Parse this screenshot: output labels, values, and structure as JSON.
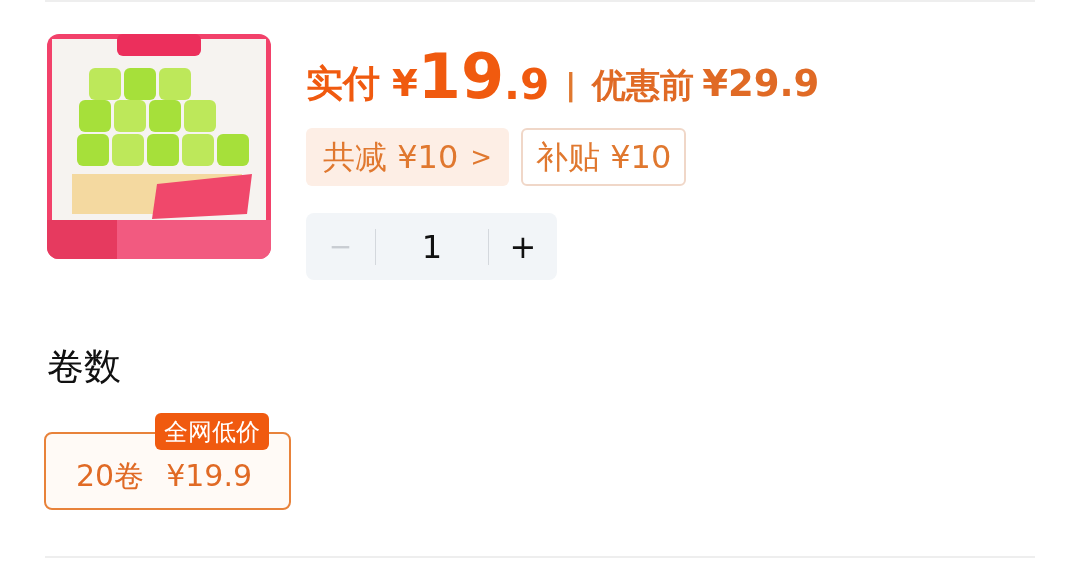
{
  "price": {
    "label": "实付",
    "currency": "¥",
    "integer": "19",
    "decimal": ".9",
    "separator": "|",
    "original_label": "优惠前",
    "original_price": "¥29.9"
  },
  "tags": [
    {
      "kind": "discount",
      "text": "共减 ¥10",
      "chevron": ">"
    },
    {
      "kind": "subsidy",
      "text": "补贴 ¥10"
    }
  ],
  "stepper": {
    "minus": "−",
    "minus_disabled": true,
    "value": "1",
    "plus": "+"
  },
  "spec": {
    "title": "卷数",
    "options": [
      {
        "label": "20卷",
        "price": "¥19.9",
        "badge": "全网低价",
        "selected": true
      }
    ]
  }
}
